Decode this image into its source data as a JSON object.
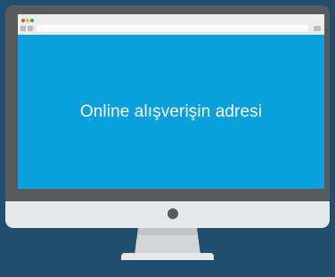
{
  "screen": {
    "headline": "Online alışverişin adresi"
  },
  "colors": {
    "background": "#1f4e6f",
    "bezel": "#595a5c",
    "screen": "#0aa0dd",
    "chin": "#e6e7e8",
    "window_close": "#e94b3c",
    "window_minimize": "#f3b531",
    "window_maximize": "#2fb44b"
  },
  "icons": {
    "close": "close-dot-icon",
    "minimize": "minimize-dot-icon",
    "maximize": "maximize-dot-icon",
    "back": "back-icon",
    "forward": "forward-icon",
    "menu": "menu-icon",
    "power": "power-button-icon"
  }
}
